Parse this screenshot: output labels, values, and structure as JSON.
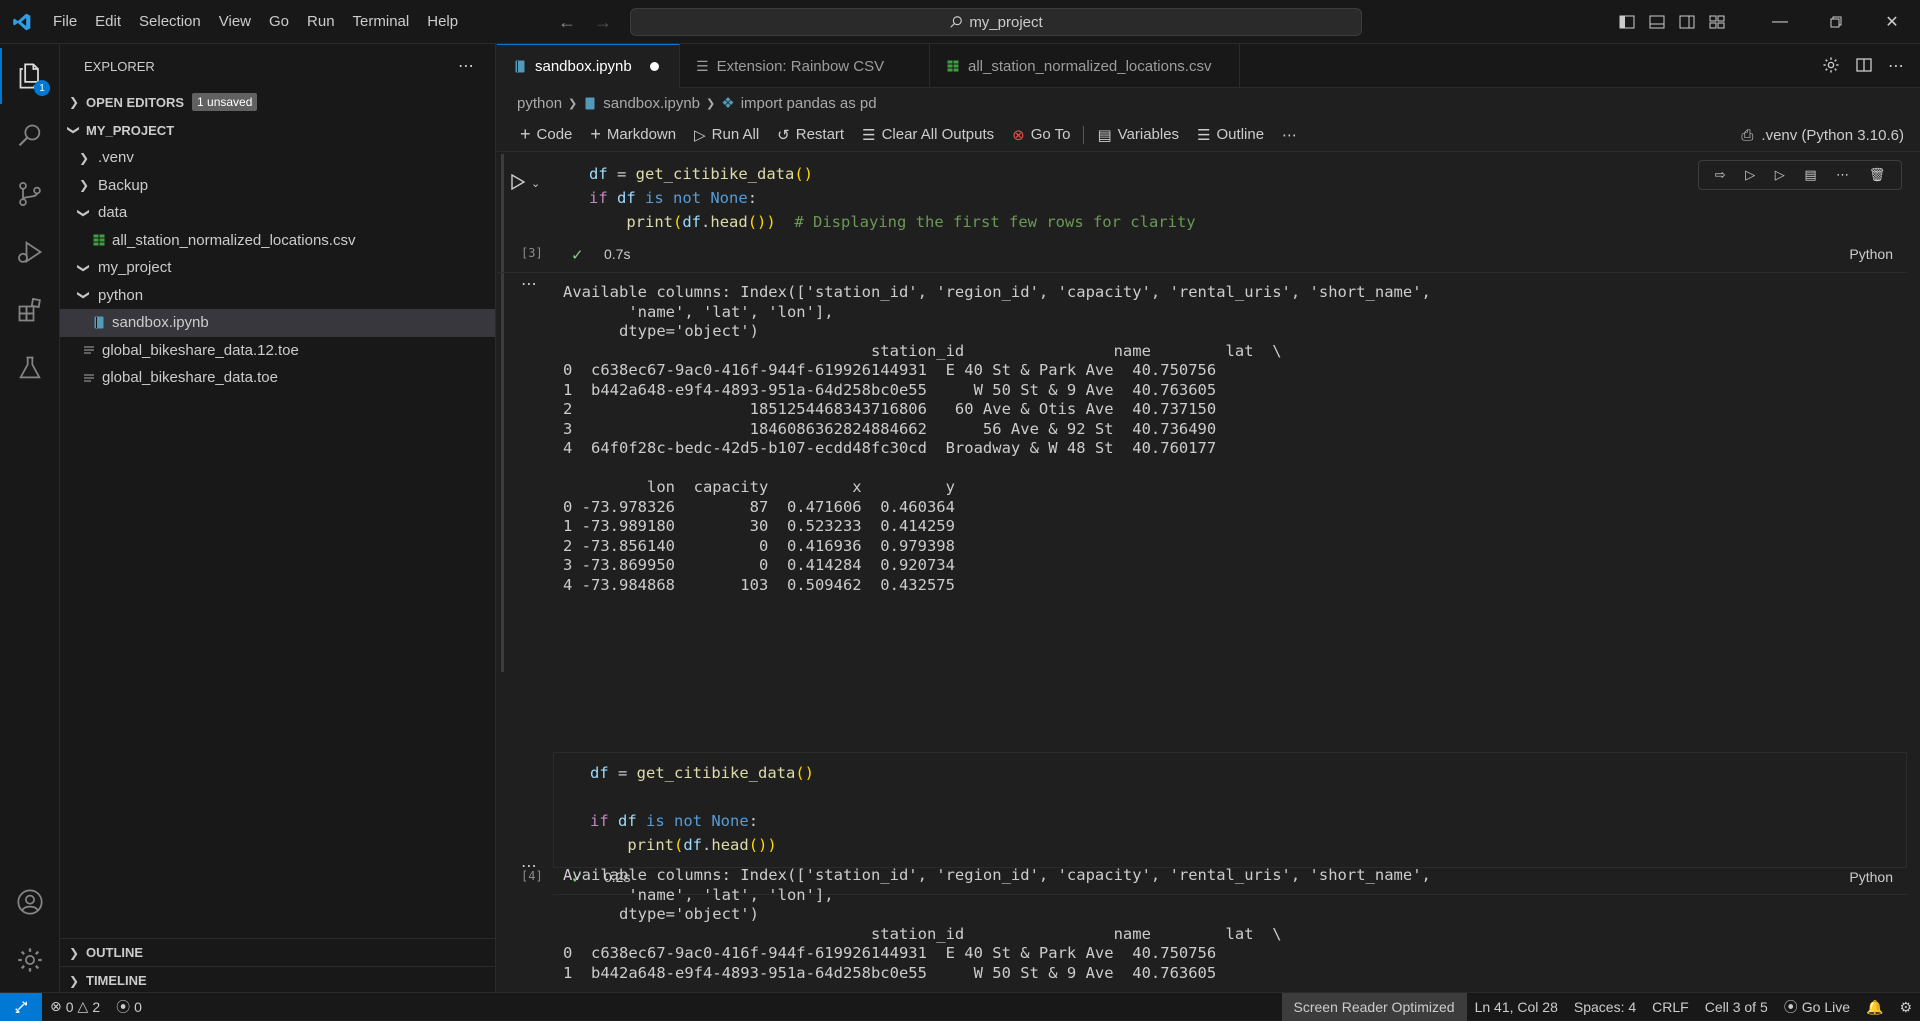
{
  "titlebar": {
    "menu": [
      "File",
      "Edit",
      "Selection",
      "View",
      "Go",
      "Run",
      "Terminal",
      "Help"
    ],
    "search": "my_project"
  },
  "activity": {
    "explorer_badge": "1"
  },
  "sidebar": {
    "title": "EXPLORER",
    "open_editors": "OPEN EDITORS",
    "unsaved": "1 unsaved",
    "project": "MY_PROJECT",
    "tree": [
      {
        "label": ".venv"
      },
      {
        "label": "Backup"
      },
      {
        "label": "data"
      },
      {
        "label": "all_station_normalized_locations.csv"
      },
      {
        "label": "my_project"
      },
      {
        "label": "python"
      },
      {
        "label": "sandbox.ipynb"
      },
      {
        "label": "global_bikeshare_data.12.toe"
      },
      {
        "label": "global_bikeshare_data.toe"
      }
    ],
    "outline": "OUTLINE",
    "timeline": "TIMELINE"
  },
  "tabs": [
    {
      "label": "sandbox.ipynb"
    },
    {
      "label": "Extension: Rainbow CSV"
    },
    {
      "label": "all_station_normalized_locations.csv"
    }
  ],
  "breadcrumb": [
    "python",
    "sandbox.ipynb",
    "import pandas as pd"
  ],
  "toolbar": {
    "code": "Code",
    "markdown": "Markdown",
    "run_all": "Run All",
    "restart": "Restart",
    "clear": "Clear All Outputs",
    "goto": "Go To",
    "variables": "Variables",
    "outline": "Outline",
    "kernel": ".venv (Python 3.10.6)"
  },
  "cells": [
    {
      "exec": "[3]",
      "duration": "0.7s",
      "lang": "Python",
      "output": "Available columns: Index(['station_id', 'region_id', 'capacity', 'rental_uris', 'short_name',\n       'name', 'lat', 'lon'],\n      dtype='object')\n                                 station_id                name        lat  \\\n0  c638ec67-9ac0-416f-944f-619926144931  E 40 St & Park Ave  40.750756   \n1  b442a648-e9f4-4893-951a-64d258bc0e55     W 50 St & 9 Ave  40.763605   \n2                   1851254468343716806   60 Ave & Otis Ave  40.737150   \n3                   1846086362824884662      56 Ave & 92 St  40.736490   \n4  64f0f28c-bedc-42d5-b107-ecdd48fc30cd  Broadway & W 48 St  40.760177   \n\n         lon  capacity         x         y  \n0 -73.978326        87  0.471606  0.460364  \n1 -73.989180        30  0.523233  0.414259  \n2 -73.856140         0  0.416936  0.979398  \n3 -73.869950         0  0.414284  0.920734  \n4 -73.984868       103  0.509462  0.432575  "
    },
    {
      "exec": "[4]",
      "duration": "0.2s",
      "lang": "Python",
      "output": "Available columns: Index(['station_id', 'region_id', 'capacity', 'rental_uris', 'short_name',\n       'name', 'lat', 'lon'],\n      dtype='object')\n                                 station_id                name        lat  \\\n0  c638ec67-9ac0-416f-944f-619926144931  E 40 St & Park Ave  40.750756   \n1  b442a648-e9f4-4893-951a-64d258bc0e55     W 50 St & 9 Ave  40.763605   "
    }
  ],
  "statusbar": {
    "errors": "0",
    "warnings": "2",
    "ports": "0",
    "screen_reader": "Screen Reader Optimized",
    "position": "Ln 41, Col 28",
    "spaces": "Spaces: 4",
    "eol": "CRLF",
    "cell": "Cell 3 of 5",
    "golive": "Go Live"
  }
}
